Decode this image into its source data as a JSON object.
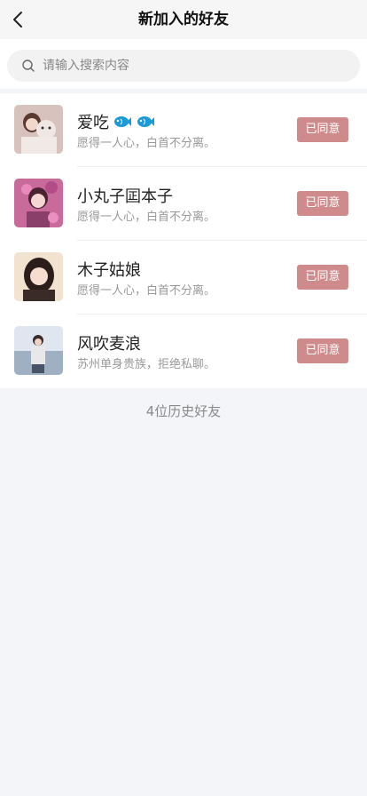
{
  "header": {
    "title": "新加入的好友",
    "back_icon": "chevron-left-icon"
  },
  "search": {
    "placeholder": "请输入搜索内容",
    "value": ""
  },
  "friends": [
    {
      "name": "爱吃",
      "signature": "愿得一人心，白首不分离。",
      "status_label": "已同意",
      "badges": 2,
      "badge_icon": "fish-icon",
      "badge_color": "#1a9ad6"
    },
    {
      "name": "小丸子囸本子",
      "signature": "愿得一人心，白首不分离。",
      "status_label": "已同意",
      "badges": 0
    },
    {
      "name": "木子姑娘",
      "signature": "愿得一人心，白首不分离。",
      "status_label": "已同意",
      "badges": 0
    },
    {
      "name": "风吹麦浪",
      "signature": "苏州单身贵族，拒绝私聊。",
      "status_label": "已同意",
      "badges": 0
    }
  ],
  "footer": {
    "history_label": "4位历史好友"
  },
  "colors": {
    "agree_button": "#cf8a8c",
    "background": "#f4f5f8"
  }
}
